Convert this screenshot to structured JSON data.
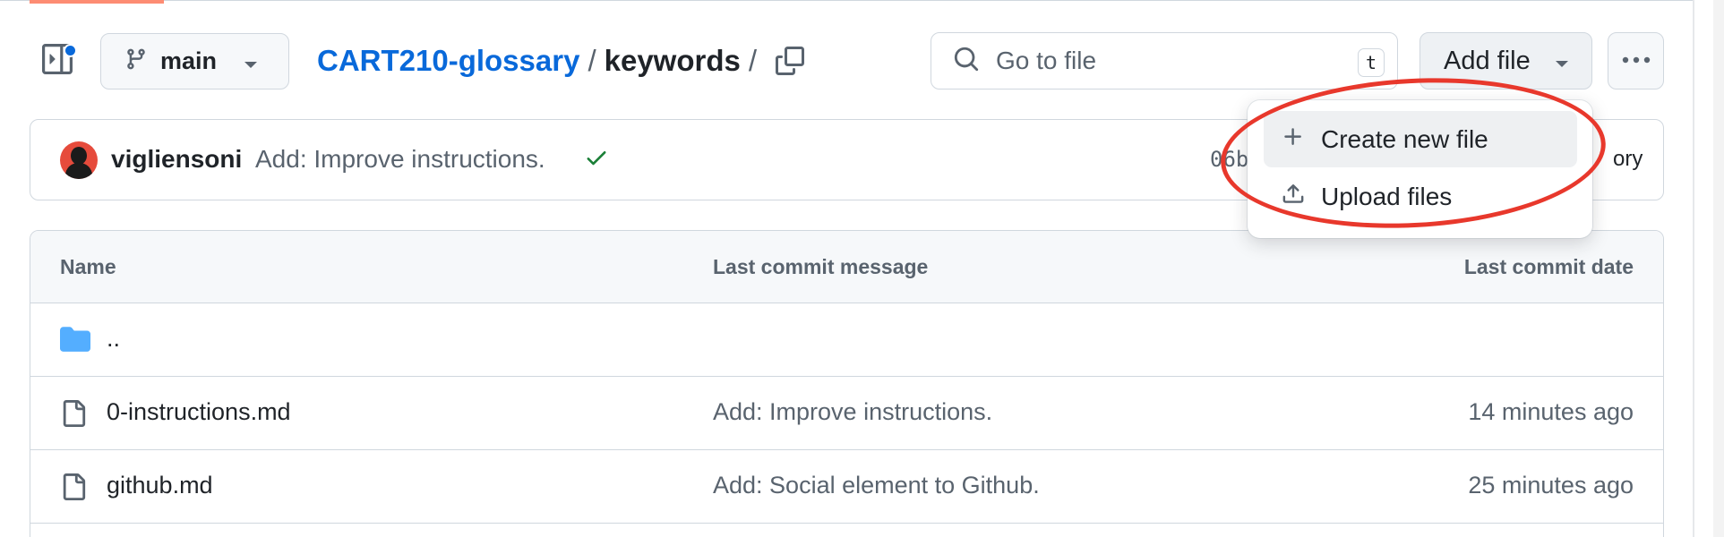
{
  "toolbar": {
    "branch_label": "main",
    "breadcrumb_repo": "CART210-glossary",
    "breadcrumb_sep": "/",
    "breadcrumb_folder": "keywords",
    "breadcrumb_trailing_sep": "/",
    "search_placeholder": "Go to file",
    "search_shortcut": "t",
    "add_file_label": "Add file"
  },
  "commit": {
    "author": "vigliensoni",
    "message": "Add: Improve instructions.",
    "status": "success",
    "hash_partial": "06b",
    "history_partial": "ory"
  },
  "files": {
    "columns": [
      "Name",
      "Last commit message",
      "Last commit date"
    ],
    "rows": [
      {
        "type": "folder",
        "name": "..",
        "message": "",
        "date": ""
      },
      {
        "type": "file",
        "name": "0-instructions.md",
        "message": "Add: Improve instructions.",
        "date": "14 minutes ago"
      },
      {
        "type": "file",
        "name": "github.md",
        "message": "Add: Social element to Github.",
        "date": "25 minutes ago"
      }
    ]
  },
  "add_file_menu": {
    "items": [
      {
        "label": "Create new file",
        "icon": "plus-icon"
      },
      {
        "label": "Upload files",
        "icon": "upload-icon"
      }
    ]
  },
  "colors": {
    "link": "#0969da",
    "accent_tab": "#fd8c73",
    "annotation_circle": "#e8382c",
    "success": "#1a7f37",
    "folder": "#54aeff"
  }
}
